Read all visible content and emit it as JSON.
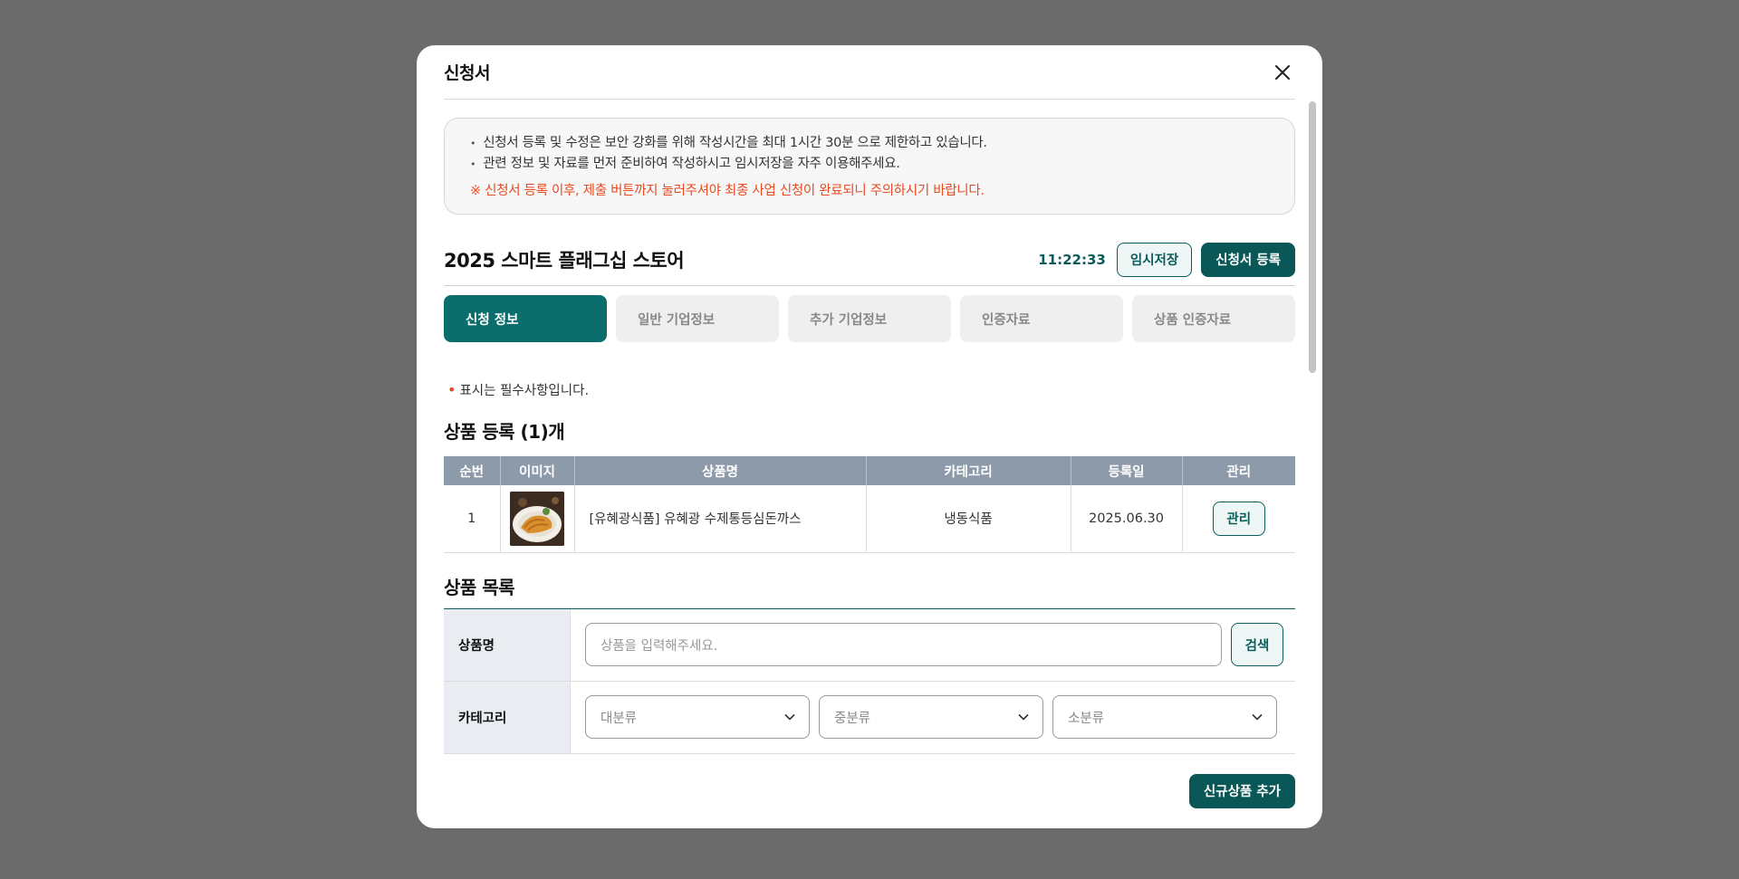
{
  "modal": {
    "title": "신청서"
  },
  "notice": {
    "lines": [
      "신청서 등록 및 수정은 보안 강화를 위해 작성시간을 최대 1시간 30분 으로 제한하고 있습니다.",
      "관련 정보 및 자료를 먼저 준비하여 작성하시고 임시저장을 자주 이용해주세요."
    ],
    "warning": "※ 신청서 등록 이후, 제출 버튼까지 눌러주셔야 최종 사업 신청이 완료되니 주의하시기 바랍니다."
  },
  "project": {
    "title": "2025 스마트 플래그십 스토어",
    "timer": "11:22:33",
    "save_label": "임시저장",
    "register_label": "신청서 등록"
  },
  "steps": [
    "신청 정보",
    "일반 기업정보",
    "추가 기업정보",
    "인증자료",
    "상품 인증자료"
  ],
  "required_note": "표시는 필수사항입니다.",
  "registration": {
    "title": "상품 등록 (1)개",
    "columns": [
      "순번",
      "이미지",
      "상품명",
      "카테고리",
      "등록일",
      "관리"
    ],
    "rows": [
      {
        "no": "1",
        "name": "[유혜광식품] 유혜광 수제통등심돈까스",
        "category": "냉동식품",
        "date": "2025.06.30",
        "manage": "관리"
      }
    ]
  },
  "product_list": {
    "title": "상품 목록",
    "name_label": "상품명",
    "name_placeholder": "상품을 입력해주세요.",
    "search_label": "검색",
    "category_label": "카테고리",
    "category_selects": [
      "대분류",
      "중분류",
      "소분류"
    ],
    "add_label": "신규상품 추가"
  },
  "colors": {
    "primary": "#0a5757",
    "accent_active": "#0c6d6d",
    "warning": "#e84a1f",
    "table_header": "#8c9aaa"
  }
}
